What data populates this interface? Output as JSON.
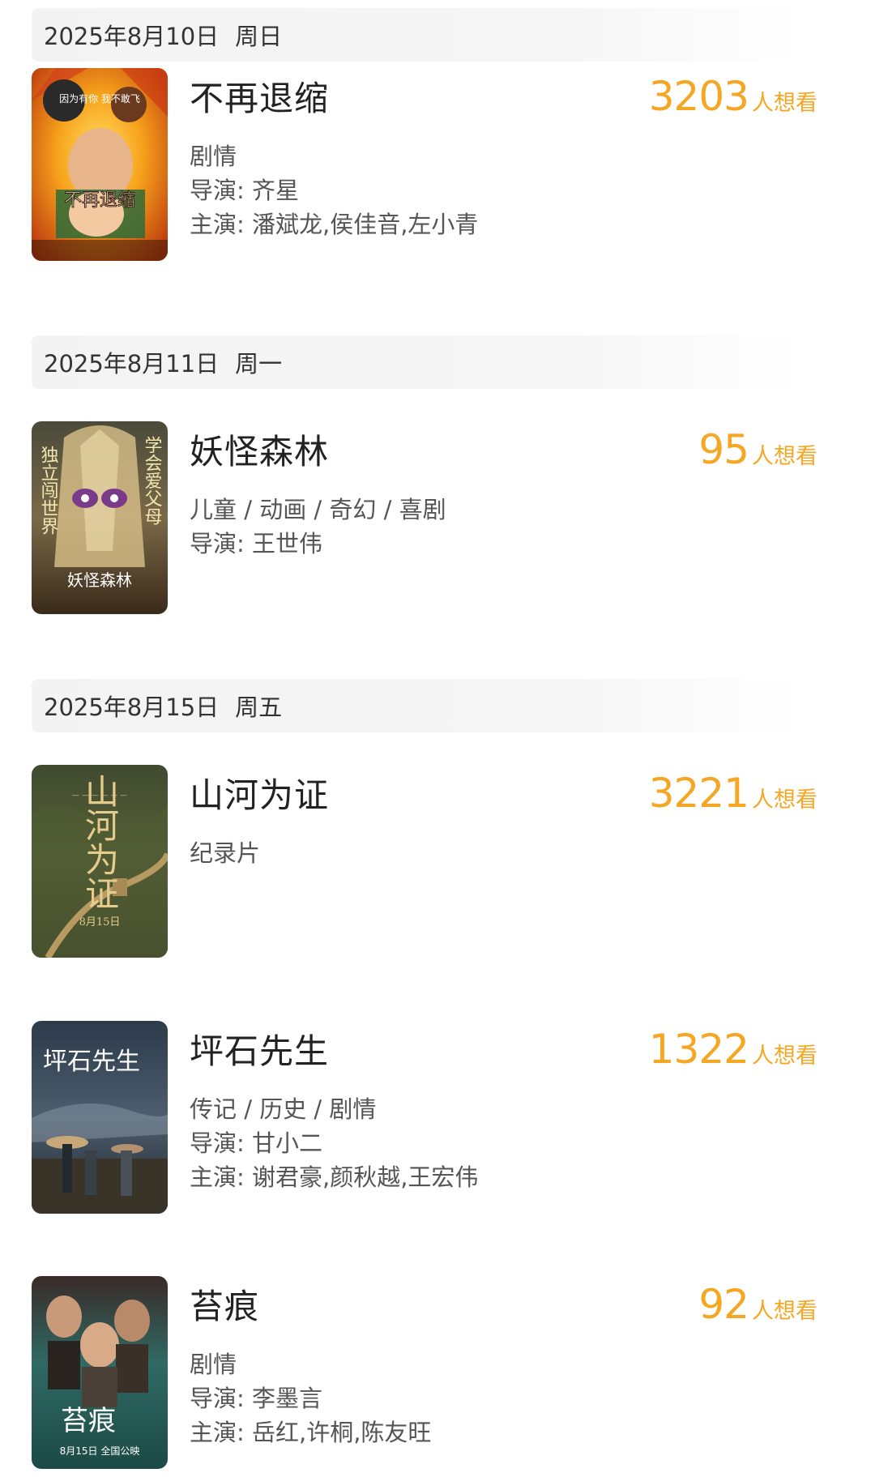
{
  "accent_color": "#f5a623",
  "want_suffix": "人想看",
  "groups": [
    {
      "date": "2025年8月10日",
      "weekday": "周日",
      "movies": [
        {
          "title": "不再退缩",
          "want_count": "3203",
          "genres": "剧情",
          "director": "导演: 齐星",
          "cast": "主演: 潘斌龙,侯佳音,左小青",
          "poster_text": "不再退缩",
          "poster_slogan": "因为有你 我不敢飞"
        }
      ]
    },
    {
      "date": "2025年8月11日",
      "weekday": "周一",
      "movies": [
        {
          "title": "妖怪森林",
          "want_count": "95",
          "genres": "儿童 / 动画 / 奇幻 / 喜剧",
          "director": "导演: 王世伟",
          "poster_text": "妖怪森林",
          "poster_left": "独立闯世界",
          "poster_right": "学会爱父母"
        }
      ]
    },
    {
      "date": "2025年8月15日",
      "weekday": "周五",
      "movies": [
        {
          "title": "山河为证",
          "want_count": "3221",
          "genres": "纪录片",
          "poster_text": "山河为证",
          "poster_date": "8月15日"
        },
        {
          "title": "坪石先生",
          "want_count": "1322",
          "genres": "传记 / 历史 / 剧情",
          "director": "导演: 甘小二",
          "cast": "主演: 谢君豪,颜秋越,王宏伟",
          "poster_text": "坪石先生"
        },
        {
          "title": "苔痕",
          "want_count": "92",
          "genres": "剧情",
          "director": "导演: 李墨言",
          "cast": "主演: 岳红,许桐,陈友旺",
          "poster_text": "苔痕",
          "poster_date": "8月15日 全国公映"
        }
      ]
    }
  ]
}
